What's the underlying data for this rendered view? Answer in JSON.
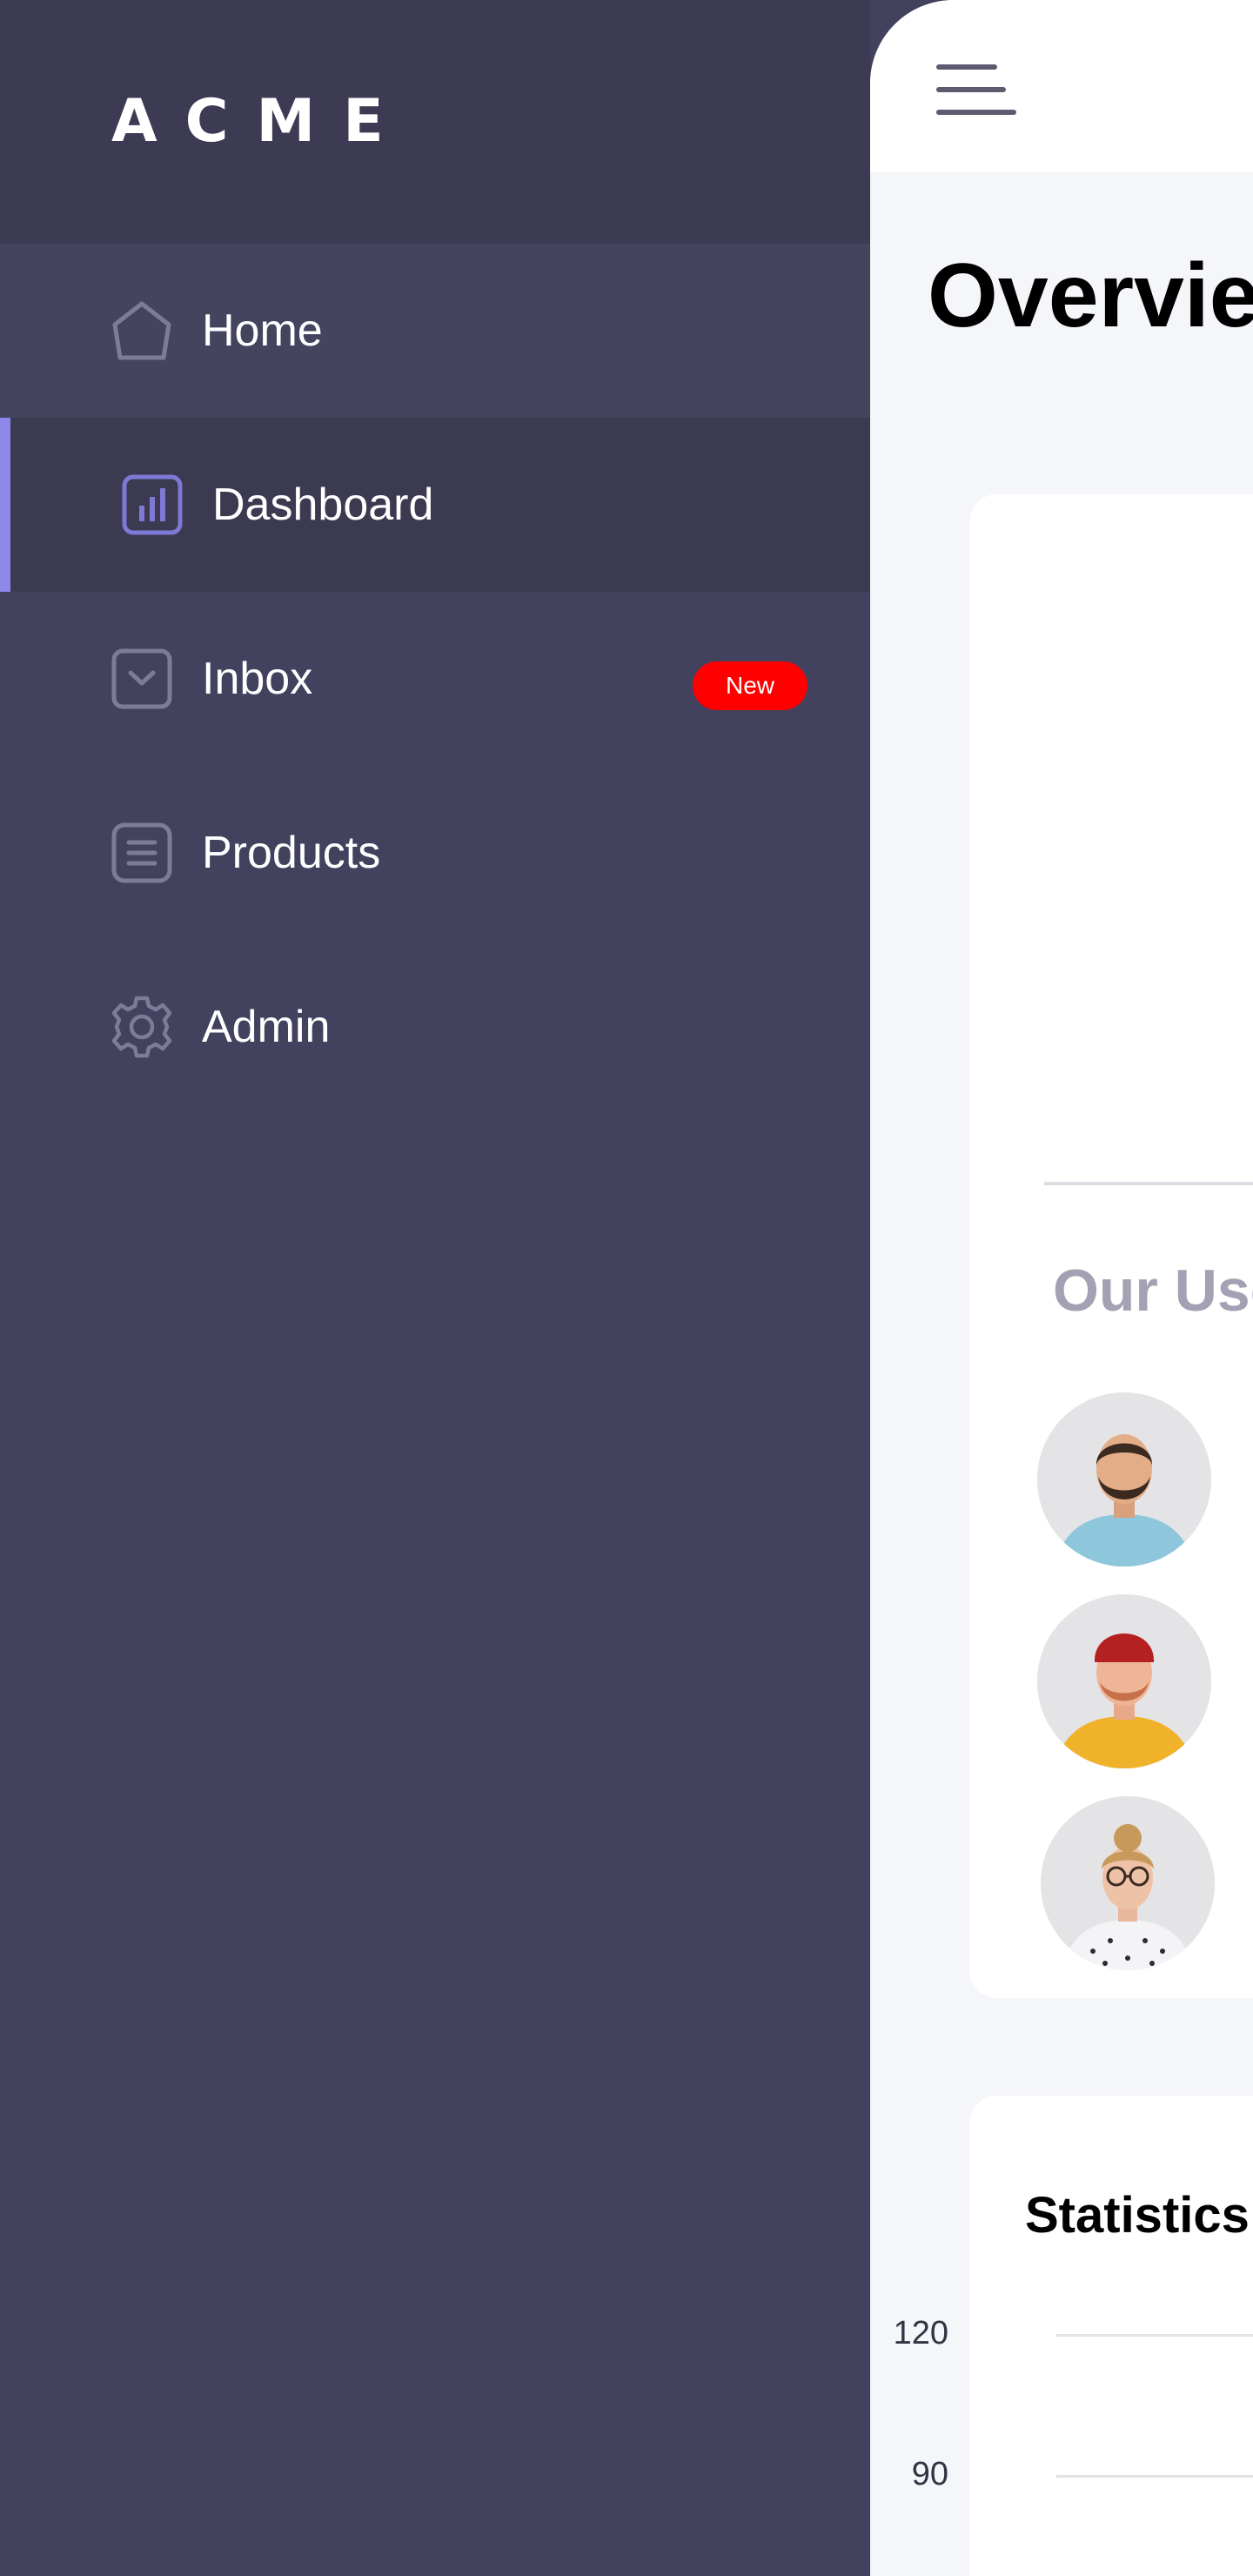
{
  "brand": {
    "logo": "ACME"
  },
  "sidebar": {
    "items": [
      {
        "label": "Home",
        "icon": "home-icon"
      },
      {
        "label": "Dashboard",
        "icon": "bar-chart-icon",
        "active": true
      },
      {
        "label": "Inbox",
        "icon": "inbox-icon",
        "badge": "New"
      },
      {
        "label": "Products",
        "icon": "document-icon"
      },
      {
        "label": "Admin",
        "icon": "gear-icon"
      }
    ]
  },
  "header": {
    "menu_icon": "hamburger-menu-icon"
  },
  "main": {
    "title": "Overvie",
    "users": {
      "heading": "Our Use",
      "avatars": [
        "user-avatar-1",
        "user-avatar-2",
        "user-avatar-3"
      ]
    },
    "statistics": {
      "title": "Statistics",
      "y_ticks": [
        "120",
        "90"
      ]
    }
  },
  "colors": {
    "sidebar_bg": "#42415e",
    "logo_bar_bg": "#3c3b53",
    "active_accent": "#8f87ea",
    "badge_bg": "#ff0000",
    "main_bg": "#f5f6fa"
  }
}
